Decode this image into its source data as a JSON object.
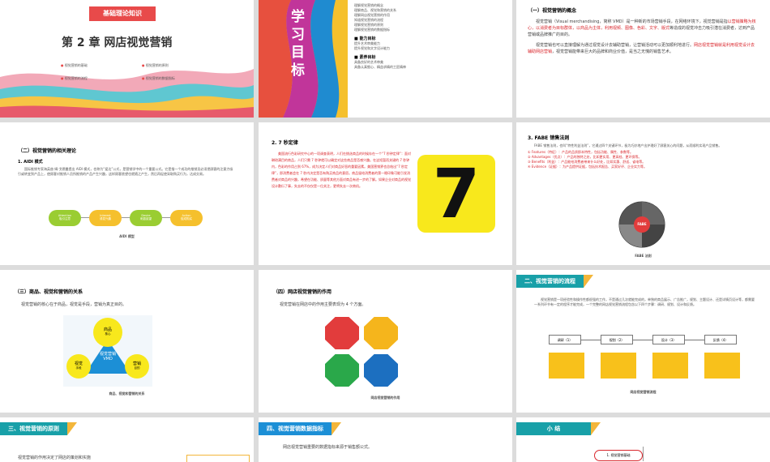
{
  "slides": {
    "s1": {
      "tag": "基础理论知识",
      "chapter": "第 2 章  网店视觉营销",
      "items": [
        "视觉营销的基础",
        "视觉营销的流程",
        "视觉营销的原则",
        "视觉营销的数据指标"
      ]
    },
    "s2": {
      "title": "学习目标",
      "items": [
        "理解视觉营销的概念",
        "理解商品、视觉和营销的关系",
        "理解网店视觉营销的作用",
        "知道视觉营销的流程",
        "理解视觉营销的原则",
        "理解视觉营销的数据指标"
      ],
      "ability_head": "能力目标",
      "ability": [
        "提升艺术审美能力",
        "提升视觉和文字设计能力"
      ],
      "quality_head": "素养目标",
      "quality": [
        "具备良好的艺术审美",
        "具备认真细心、精益求精的工匠精神"
      ]
    },
    "s3": {
      "head": "（一）视觉营销的概念",
      "p1a": "视觉营销（Visual merchandising，简称 VMD）是一种新的市场营销手段，在网络环境下，视觉营销是指",
      "p1b": "以营销策略为核心，以消费者为目标群体，以商品为主体，利用视频、图像、色彩、文字、版式",
      "p1c": "等造成的视觉冲击力吸引潜在消费者，达到产品营销或品牌推广的目的。",
      "p2a": "视觉营销也可以直接理解为通过视觉设计去辅助营销，让营销活动可以更加顺利地进行。",
      "p2b": "网店视觉营销就是利用视觉设计去辅助网店营销",
      "p2c": "，视觉营销能带来巨大的品牌和商业价值，是当之无愧的销售艺术。"
    },
    "s4": {
      "head": "（二）视觉营销的相关理论",
      "sub": "1. AIDI 模式",
      "body": "国际推销专家海英兹·姆·戈德曼提出 AIDI 模式，也称为“爱达”公式，是营销学中的一个重要公式。它是指一个成功的推销员必须把顾客的注意力吸引或转变到产品上，使顾客对推销人员所推销的产品产生兴趣，这样顾客欲望也就随之产生，然后再促使采取购买行为，达成交易。",
      "nodes": [
        [
          "Attention",
          "吸引注意"
        ],
        [
          "Interest",
          "诱发兴趣"
        ],
        [
          "Desire",
          "刺激欲望"
        ],
        [
          "Action",
          "促成购买"
        ]
      ],
      "caption": "AIDI 模型"
    },
    "s5": {
      "head": "2. 7 秒定律",
      "body1": "美国流行色彩研究中心的一项调查表明，人们在挑选商品的时候存在一个“7 秒钟定律”：面对琳琅满目的商品，人们只需 7 秒钟就可以确定对这些商品是否感兴趣。在这短暂而关键的 7 秒钟内，色彩的作用占到 67%，成为决定人们对商品好恶的重要因素。美国营销界也总结出“7 秒定律”，即消费者会在 7 秒内决定是否有购买商品的意愿。商品留给消费者的第一眼印象可能引发消费者对商品的兴趣，希望在功能、质量等其他方面对商品有进一步的了解。如果企业对商品的视觉设计敷衍了事，失去的不仅仅是一位关注，更将失去一次商机。",
      "seven": "7"
    },
    "s6": {
      "head": "3. FABE 销售法则",
      "intro": "FABE 销售法则，也叫“特性利益法则”，它通过四个关键环节，极为巧妙地产出护理好了顾客关心的问题，从而顺利实现产品销售。",
      "items": [
        "① Features（特征）：产品的品质即本特性，包括功能、属性、参数等。",
        "② Advantages（优点）：产品的独特之处，比如更实用、更高档、更环保等。",
        "③ Benefits（利益）：产品能给消费者带来什么好处，比如实惠、舒适、省电等。",
        "④ Evidence（证据）：为产品提供证据，包括技术报告、买家好评、企业实力等。"
      ],
      "center": "FABE",
      "caption": "FABE 法则"
    },
    "s7": {
      "head": "（三）商品、视觉和营销的关系",
      "body": "视觉营销的核心在于商品，视觉是手段，营销为真正目的。",
      "top": "商品",
      "top_sub": "核心",
      "left": "视觉",
      "left_sub": "手段",
      "right": "营销",
      "right_sub": "目的",
      "center": "视觉营销\nVMD",
      "caption": "商品、视觉和营销的关系"
    },
    "s8": {
      "head": "（四）网店视觉营销的作用",
      "body": "视觉营销在网店中的作用主要表现为 4 个方面。",
      "caption": "网店视觉营销的作用"
    },
    "s9": {
      "banner": "二、视觉营销的流程",
      "body": "视觉营销是一项经验性和操作性都很强的工作，不是通过几次就能完成的，单独的商品展示、广告推广，规划、主题设计、还是详情页设计等，都需要一系列环节有一定的程序才能完成，一个完整的网店视觉营销流程包含以下四个步骤：调研、规划、设计和反馈。",
      "steps": [
        "调研（1）",
        "规划（2）",
        "设计（3）",
        "反馈（4）"
      ],
      "caption": "网店视觉营销流程"
    },
    "s10": {
      "banner": "三、视觉营销的原则",
      "body": "视觉营销的作用决定了网店的策划和实施"
    },
    "s11": {
      "banner": "四、视觉营销数据指标",
      "body": "网店视觉营销重要的数据指标来源于销售额公式。"
    },
    "s12": {
      "banner": "小    结",
      "node": "1. 视觉营销基础"
    }
  },
  "colors": {
    "teal": "#18a0a8",
    "yellow": "#f8c11b",
    "red": "#d9262c",
    "blue": "#1c8fd6"
  }
}
